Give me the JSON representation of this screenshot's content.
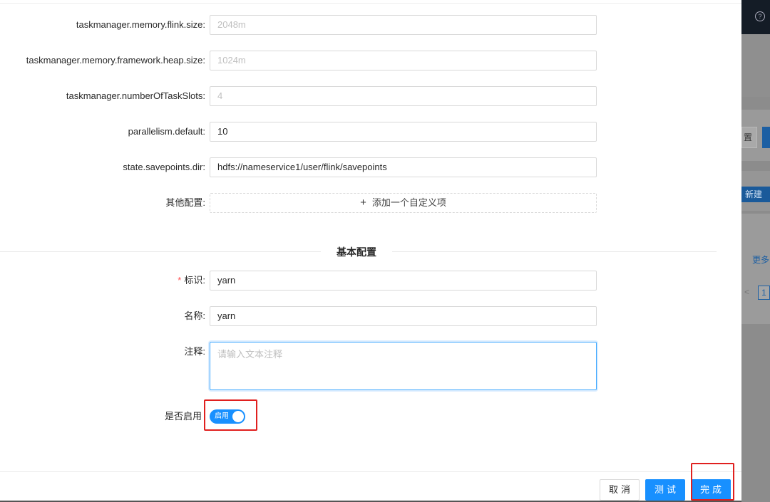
{
  "background": {
    "help_icon": "?",
    "button_a_label": "置",
    "new_label": "新建",
    "more_label": "更多",
    "prev_glyph": "<",
    "page_number": "1"
  },
  "form": {
    "fields": [
      {
        "label": "taskmanager.memory.flink.size",
        "value": "2048m",
        "placeholder": true
      },
      {
        "label": "taskmanager.memory.framework.heap.size",
        "value": "1024m",
        "placeholder": true
      },
      {
        "label": "taskmanager.numberOfTaskSlots",
        "value": "4",
        "placeholder": true
      },
      {
        "label": "parallelism.default",
        "value": "10",
        "placeholder": false
      },
      {
        "label": "state.savepoints.dir",
        "value": "hdfs://nameservice1/user/flink/savepoints",
        "placeholder": false
      }
    ],
    "other_config": {
      "label": "其他配置",
      "add_label": "添加一个自定义项",
      "add_icon": "plus-icon"
    },
    "section_title": "基本配置",
    "identifier": {
      "label": "标识",
      "required_mark": "*",
      "value": "yarn"
    },
    "name": {
      "label": "名称",
      "value": "yarn"
    },
    "note": {
      "label": "注释",
      "placeholder": "请输入文本注释"
    },
    "enable": {
      "label": "是否启用",
      "switch_text": "启用",
      "checked": true
    },
    "colon": ":"
  },
  "footer": {
    "cancel_label": "取消",
    "test_label": "测试",
    "done_label": "完成"
  },
  "colors": {
    "primary": "#1890ff",
    "highlight": "#e0201f",
    "required": "#ff4d4f"
  }
}
